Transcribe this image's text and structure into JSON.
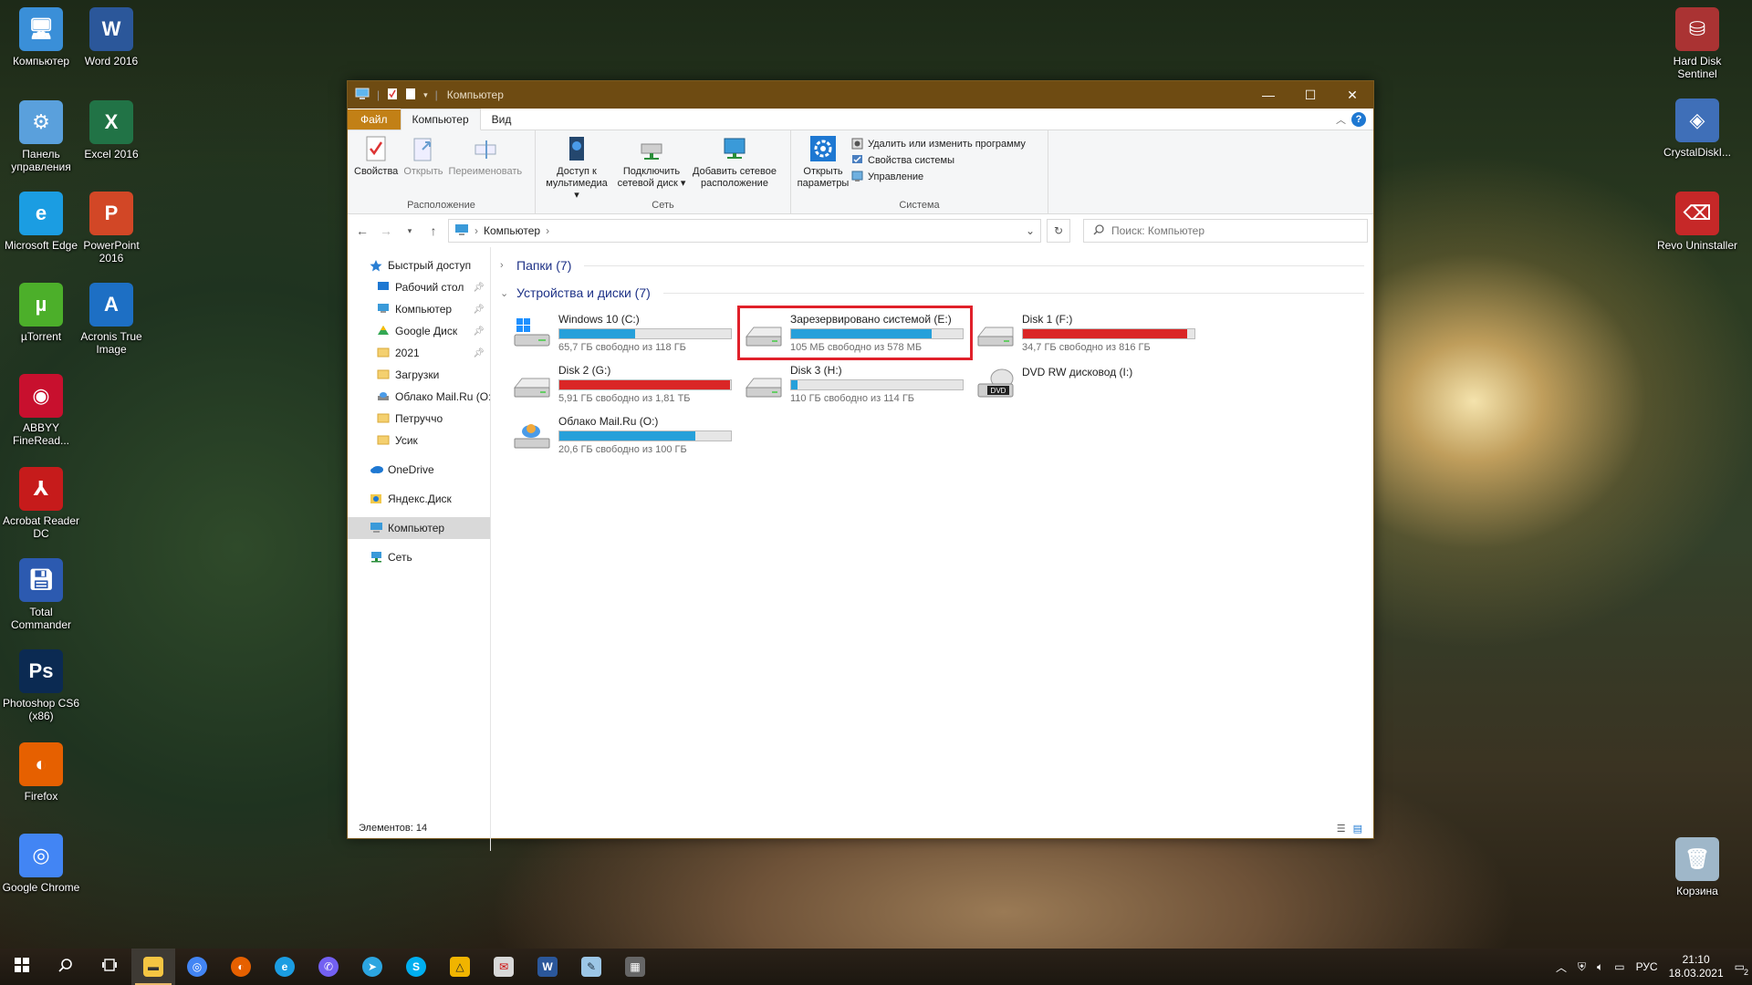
{
  "desktop": {
    "left_icons": [
      {
        "label": "Компьютер",
        "icon": "computer-icon"
      },
      {
        "label": "Word 2016",
        "icon": "word-icon"
      },
      {
        "label": "Панель управления",
        "icon": "control-panel-icon"
      },
      {
        "label": "Excel 2016",
        "icon": "excel-icon"
      },
      {
        "label": "Microsoft Edge",
        "icon": "edge-icon"
      },
      {
        "label": "PowerPoint 2016",
        "icon": "powerpoint-icon"
      },
      {
        "label": "µTorrent",
        "icon": "utorrent-icon"
      },
      {
        "label": "Acronis True Image",
        "icon": "acronis-icon"
      },
      {
        "label": "ABBYY FineRead...",
        "icon": "abbyy-icon"
      },
      {
        "label": "Acrobat Reader DC",
        "icon": "acrobat-icon"
      },
      {
        "label": "Total Commander",
        "icon": "total-commander-icon"
      },
      {
        "label": "Photoshop CS6 (x86)",
        "icon": "photoshop-icon"
      },
      {
        "label": "Firefox",
        "icon": "firefox-icon"
      },
      {
        "label": "Google Chrome",
        "icon": "chrome-icon"
      }
    ],
    "right_icons": [
      {
        "label": "Hard Disk Sentinel",
        "icon": "hard-disk-sentinel-icon"
      },
      {
        "label": "CrystalDiskI...",
        "icon": "crystaldiskinfo-icon"
      },
      {
        "label": "Revo Uninstaller",
        "icon": "revo-uninstaller-icon"
      },
      {
        "label": "Корзина",
        "icon": "recycle-bin-icon"
      }
    ]
  },
  "window": {
    "title": "Компьютер",
    "controls": {
      "minimize": "—",
      "maximize": "☐",
      "close": "✕"
    },
    "tabs": {
      "file": "Файл",
      "computer": "Компьютер",
      "view": "Вид"
    },
    "help": "?",
    "ribbon": {
      "location": {
        "label": "Расположение",
        "properties": "Свойства",
        "open": "Открыть",
        "rename": "Переименовать"
      },
      "network": {
        "label": "Сеть",
        "media": "Доступ к мультимедиа ▾",
        "map_drive": "Подключить сетевой диск ▾",
        "add_location": "Добавить сетевое расположение"
      },
      "system": {
        "label": "Система",
        "open_settings": "Открыть параметры",
        "uninstall": "Удалить или изменить программу",
        "system_props": "Свойства системы",
        "manage": "Управление"
      }
    },
    "address": {
      "path": "Компьютер",
      "search_placeholder": "Поиск: Компьютер"
    },
    "nav": {
      "quick_access": "Быстрый доступ",
      "quick_items": [
        {
          "label": "Рабочий стол",
          "pinned": true
        },
        {
          "label": "Компьютер",
          "pinned": true
        },
        {
          "label": "Google Диск",
          "pinned": true
        },
        {
          "label": "2021",
          "pinned": true
        },
        {
          "label": "Загрузки",
          "pinned": false
        },
        {
          "label": "Облако Mail.Ru (O:",
          "pinned": false
        },
        {
          "label": "Петруччо",
          "pinned": false
        },
        {
          "label": "Усик",
          "pinned": false
        }
      ],
      "onedrive": "OneDrive",
      "yandex": "Яндекс.Диск",
      "computer": "Компьютер",
      "network": "Сеть"
    },
    "groups": {
      "folders": "Папки (7)",
      "devices": "Устройства и диски (7)"
    },
    "drives": [
      {
        "name": "Windows 10 (C:)",
        "free": "65,7 ГБ свободно из 118 ГБ",
        "used_fraction": 0.44,
        "color": "#26a0da",
        "icon": "windows-drive-icon",
        "highlight": false
      },
      {
        "name": "Зарезервировано системой (E:)",
        "free": "105 МБ свободно из 578 МБ",
        "used_fraction": 0.82,
        "color": "#26a0da",
        "icon": "hdd-icon",
        "highlight": true
      },
      {
        "name": "Disk 1 (F:)",
        "free": "34,7 ГБ свободно из 816 ГБ",
        "used_fraction": 0.96,
        "color": "#da2626",
        "icon": "hdd-icon",
        "highlight": false
      },
      {
        "name": "Disk 2 (G:)",
        "free": "5,91 ГБ свободно из 1,81 ТБ",
        "used_fraction": 0.997,
        "color": "#da2626",
        "icon": "hdd-icon",
        "highlight": false
      },
      {
        "name": "Disk 3 (H:)",
        "free": "110 ГБ свободно из 114 ГБ",
        "used_fraction": 0.035,
        "color": "#26a0da",
        "icon": "hdd-icon",
        "highlight": false
      },
      {
        "name": "DVD RW дисковод (I:)",
        "free": "",
        "used_fraction": null,
        "color": "",
        "icon": "dvd-drive-icon",
        "highlight": false
      },
      {
        "name": "Облако Mail.Ru (O:)",
        "free": "20,6 ГБ свободно из 100 ГБ",
        "used_fraction": 0.79,
        "color": "#26a0da",
        "icon": "cloud-drive-icon",
        "highlight": false
      }
    ],
    "status": "Элементов: 14"
  },
  "taskbar": {
    "apps": [
      "start-icon",
      "search-icon",
      "task-view-icon",
      "explorer-icon",
      "chrome-icon",
      "firefox-icon",
      "edge-icon",
      "viber-icon",
      "telegram-icon",
      "skype-icon",
      "archicad-icon",
      "mail-icon",
      "word-icon",
      "notepad-icon",
      "calculator-icon"
    ],
    "lang": "РУС",
    "time": "21:10",
    "date": "18.03.2021",
    "notifications": "2"
  }
}
